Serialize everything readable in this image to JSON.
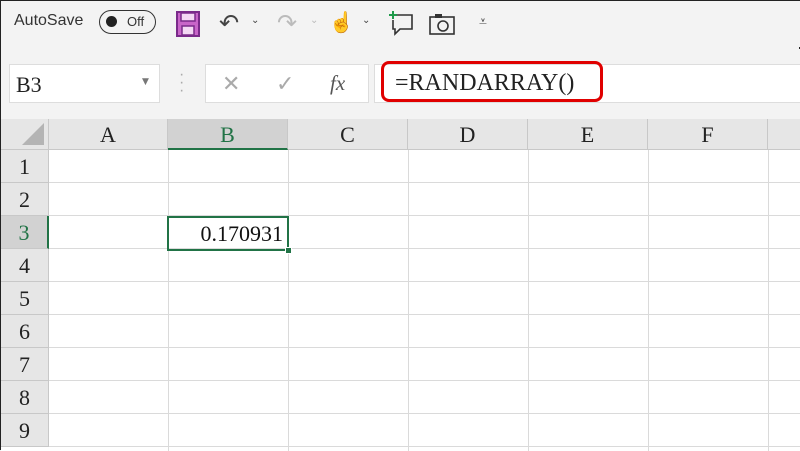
{
  "qat": {
    "autosave_label": "AutoSave",
    "toggle_state": "Off",
    "icons": [
      "save-icon",
      "undo-icon",
      "redo-icon",
      "touch-mode-icon",
      "new-comment-icon",
      "camera-icon",
      "customize-qat-icon"
    ]
  },
  "formula_bar": {
    "name_box": "B3",
    "cancel": "✕",
    "enter": "✓",
    "fx": "fx",
    "formula": "=RANDARRAY()"
  },
  "sheet": {
    "columns": [
      "A",
      "B",
      "C",
      "D",
      "E",
      "F"
    ],
    "rows": [
      "1",
      "2",
      "3",
      "4",
      "5",
      "6",
      "7",
      "8",
      "9"
    ],
    "active_cell": "B3",
    "active_value": "0.170931",
    "accent": "#217346"
  }
}
